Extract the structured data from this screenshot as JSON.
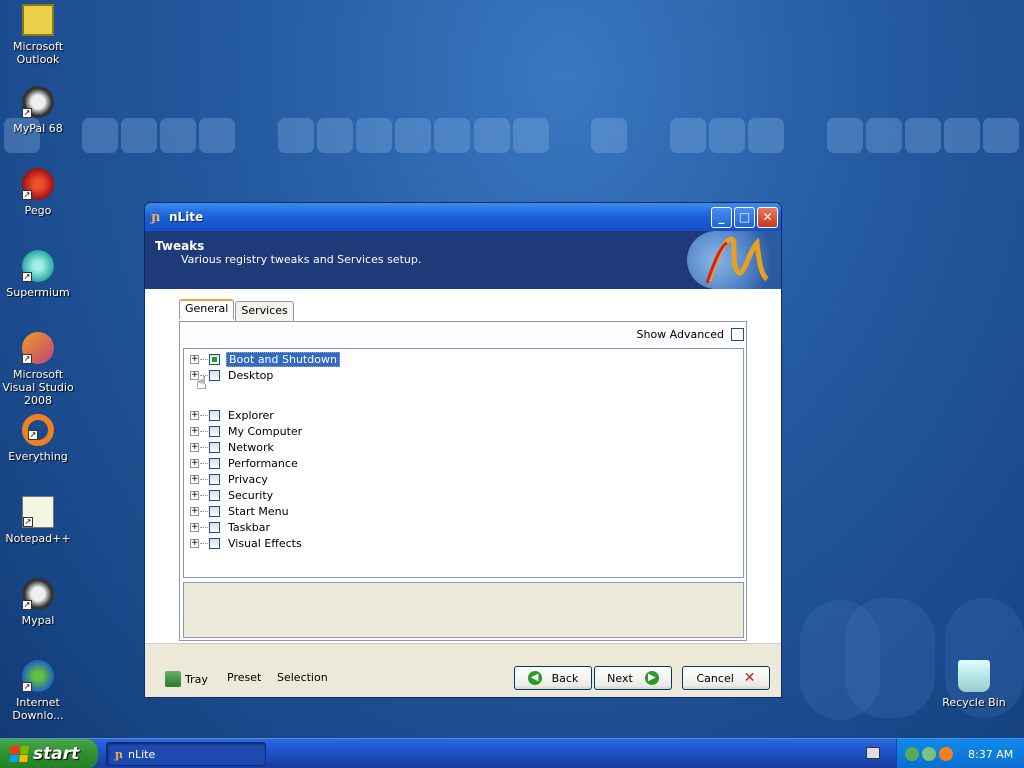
{
  "desktop": {
    "icons": [
      {
        "label": "Microsoft Outlook",
        "icon": "outlook-icon"
      },
      {
        "label": "MyPal 68",
        "icon": "mypal-icon"
      },
      {
        "label": "Pego",
        "icon": "pego-icon"
      },
      {
        "label": "Supermium",
        "icon": "supermium-icon"
      },
      {
        "label": "Microsoft Visual Studio 2008",
        "icon": "visual-studio-icon"
      },
      {
        "label": "Everything",
        "icon": "everything-icon"
      },
      {
        "label": "Notepad++",
        "icon": "notepadpp-icon"
      },
      {
        "label": "Mypal",
        "icon": "mypal-icon"
      },
      {
        "label": "Internet Downlo...",
        "icon": "internet-download-icon"
      },
      {
        "label": "Recycle Bin",
        "icon": "recycle-bin-icon"
      }
    ]
  },
  "window": {
    "title": "nLite",
    "header_title": "Tweaks",
    "header_subtitle": "Various registry tweaks and Services setup.",
    "tabs": [
      "General",
      "Services"
    ],
    "show_advanced_label": "Show Advanced",
    "tree_items": [
      {
        "label": "Boot and Shutdown",
        "checked": true,
        "selected": true
      },
      {
        "label": "Desktop",
        "checked": false,
        "selected": false
      },
      {
        "label": "Explorer",
        "checked": false,
        "selected": false
      },
      {
        "label": "My Computer",
        "checked": false,
        "selected": false
      },
      {
        "label": "Network",
        "checked": false,
        "selected": false
      },
      {
        "label": "Performance",
        "checked": false,
        "selected": false
      },
      {
        "label": "Privacy",
        "checked": false,
        "selected": false
      },
      {
        "label": "Security",
        "checked": false,
        "selected": false
      },
      {
        "label": "Start Menu",
        "checked": false,
        "selected": false
      },
      {
        "label": "Taskbar",
        "checked": false,
        "selected": false
      },
      {
        "label": "Visual Effects",
        "checked": false,
        "selected": false
      }
    ],
    "footer": {
      "tray_label": "Tray",
      "preset_label": "Preset",
      "selection_label": "Selection",
      "back_label": "Back",
      "next_label": "Next",
      "cancel_label": "Cancel"
    }
  },
  "taskbar": {
    "start_label": "start",
    "task_label": "nLite",
    "clock": "8:37 AM"
  },
  "colors": {
    "title_bar": "#1a5fd6",
    "header_bg": "#1e3a78",
    "selection": "#316ac5",
    "start_green": "#2f8f2f"
  }
}
